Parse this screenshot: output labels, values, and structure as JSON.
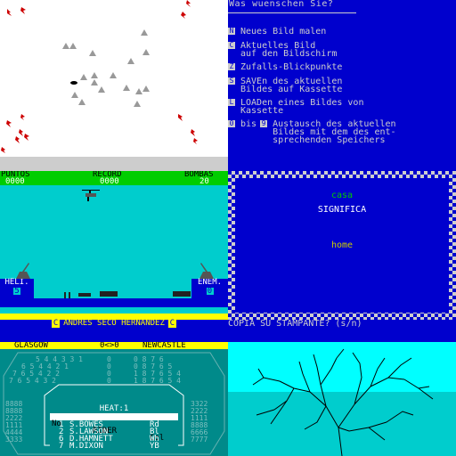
{
  "paint_menu": {
    "title": "Was wuenschen Sie?",
    "items": [
      {
        "key": "N",
        "text": "Neues Bild malen"
      },
      {
        "key": "C",
        "text": "Aktuelles Bild\nauf den Bildschirm"
      },
      {
        "key": "Z",
        "text": "Zufalls-Blickpunkte"
      },
      {
        "key": "S",
        "text": "SAVEn des aktuellen\nBildes auf Kassette"
      },
      {
        "key": "L",
        "text": "LOADen eines Bildes von\nKassette"
      },
      {
        "key": "0",
        "text": "bis",
        "key2": "9",
        "text2": "Austausch des aktuellen\nBildes mit dem des ent-\nsprechenden Speichers"
      }
    ]
  },
  "game": {
    "hud": {
      "puntos_label": "PUNTOS",
      "puntos_value": "0000",
      "record_label": "RECORD",
      "record_value": "0000",
      "bombas_label": "BOMBAS",
      "bombas_value": "20"
    },
    "left_base": {
      "label": "HELI.",
      "value": "5"
    },
    "right_base": {
      "label": "ENEM.",
      "value": "0"
    },
    "credit": "ANDRES SECO HERNANDEZ",
    "credit_badge": "C"
  },
  "dictionary": {
    "word": "casa",
    "meaning_label": "SIGNIFICA",
    "translation": "home",
    "prompt": "COPIA SU STAMPANTE? (s/n)",
    "colors": {
      "word": "#00cd00",
      "meaning": "#ffffff",
      "translation": "#cdcd00"
    }
  },
  "speedway": {
    "home": "GLASGOW",
    "score": "0<>0",
    "away": "NEWCASTLE",
    "heat_title": "HEAT:1",
    "columns": [
      "No",
      "RIDER",
      "Col"
    ],
    "riders": [
      {
        "no": "1",
        "name": "S.BOWES",
        "col": "Rd"
      },
      {
        "no": "2",
        "name": "S.LAWSON",
        "col": "Bl"
      },
      {
        "no": "6",
        "name": "D.HAMNETT",
        "col": "Wh"
      },
      {
        "no": "7",
        "name": "M.DIXON",
        "col": "YB"
      }
    ]
  },
  "colors": {
    "spectrum_blue": "#0000cd",
    "spectrum_cyan": "#00cdcd",
    "spectrum_green": "#00cd00",
    "spectrum_yellow": "#ffff00",
    "spectrum_red": "#cd0000"
  }
}
